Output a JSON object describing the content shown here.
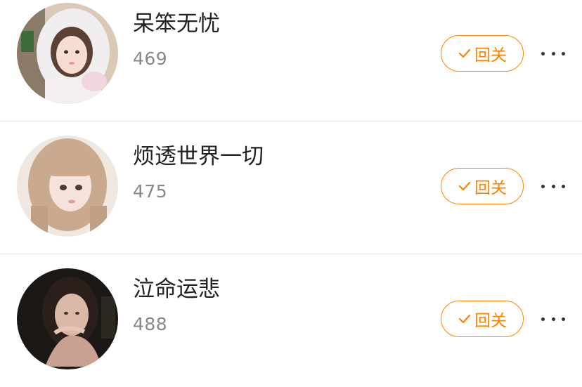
{
  "fans": [
    {
      "name": "呆笨无忧",
      "count": "469",
      "follow_label": "回关",
      "avatar": "avatar-girl-white-hood"
    },
    {
      "name": "烦透世界一切",
      "count": "475",
      "follow_label": "回关",
      "avatar": "avatar-girl-light-hair"
    },
    {
      "name": "泣命运悲",
      "count": "488",
      "follow_label": "回关",
      "avatar": "avatar-girl-dark"
    }
  ],
  "colors": {
    "accent": "#ff8200",
    "divider": "#ececec",
    "name_text": "#222222",
    "count_text": "#888888"
  }
}
